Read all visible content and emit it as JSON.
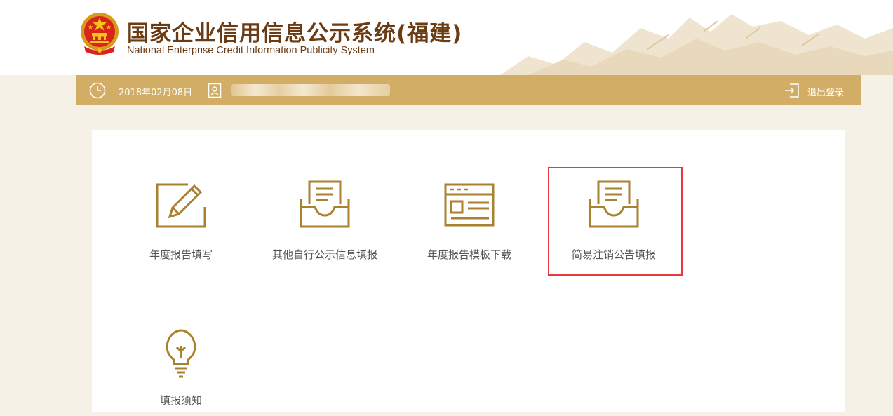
{
  "header": {
    "title_cn": "国家企业信用信息公示系统(福建)",
    "title_en": "National Enterprise Credit Information Publicity System"
  },
  "topbar": {
    "date": "2018年02月08日",
    "username": "",
    "logout_label": "退出登录"
  },
  "menu": {
    "items": [
      {
        "label": "年度报告填写",
        "icon": "edit-form-icon"
      },
      {
        "label": "其他自行公示信息填报",
        "icon": "inbox-tray-icon"
      },
      {
        "label": "年度报告模板下载",
        "icon": "template-window-icon"
      },
      {
        "label": "简易注销公告填报",
        "icon": "inbox-tray-icon",
        "highlighted": true
      },
      {
        "label": "填报须知",
        "icon": "lightbulb-icon"
      }
    ]
  },
  "colors": {
    "accent_gold": "#d2ad66",
    "icon_brown": "#a9812f",
    "title_brown": "#6b3b14",
    "highlight_red": "#e5393b",
    "page_bg": "#f6f1e6"
  }
}
